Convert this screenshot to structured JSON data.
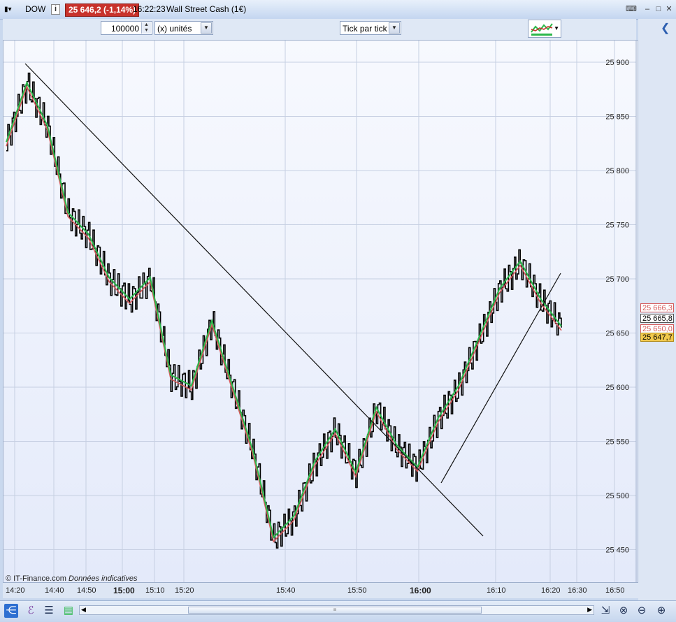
{
  "titlebar": {
    "symbol": "DOW",
    "price_badge": "25 646,2 (-1,14%)",
    "time": "16:22:23",
    "instrument": "Wall Street Cash (1€)"
  },
  "toolbar": {
    "quantity": "100000",
    "unit": "(x) unités",
    "timeframe": "Tick par tick"
  },
  "axis": {
    "y_ticks": [
      "25 900",
      "25 850",
      "25 800",
      "25 750",
      "25 700",
      "25 650",
      "25 600",
      "25 550",
      "25 500",
      "25 450"
    ],
    "x_ticks": [
      {
        "label": "14:20",
        "bold": false
      },
      {
        "label": "14:40",
        "bold": false
      },
      {
        "label": "14:50",
        "bold": false
      },
      {
        "label": "15:00",
        "bold": true
      },
      {
        "label": "15:10",
        "bold": false
      },
      {
        "label": "15:20",
        "bold": false
      },
      {
        "label": "15:40",
        "bold": false
      },
      {
        "label": "15:50",
        "bold": false
      },
      {
        "label": "16:00",
        "bold": true
      },
      {
        "label": "16:10",
        "bold": false
      },
      {
        "label": "16:20",
        "bold": false
      },
      {
        "label": "16:30",
        "bold": false
      },
      {
        "label": "16:50",
        "bold": false
      }
    ]
  },
  "price_tags": {
    "tag1": "25 666,3",
    "tag2": "25 665,8",
    "tag3": "25 650,0",
    "tag4": "25 647,7"
  },
  "watermark": {
    "source": "© IT-Finance.com",
    "note": "Données indicatives"
  },
  "colors": {
    "badge": "#c8322c",
    "ma_green": "#2bb84a",
    "ma_red": "#d55a5a",
    "price": "#000000"
  },
  "chart_data": {
    "type": "line",
    "ylim": [
      25420,
      25920
    ],
    "x": [
      "14:20",
      "14:30",
      "14:40",
      "14:50",
      "15:00",
      "15:10",
      "15:20",
      "15:30",
      "15:40",
      "15:50",
      "16:00",
      "16:10",
      "16:20",
      "16:25"
    ],
    "series": [
      {
        "values": [
          25825,
          25880,
          25840,
          25760,
          25740,
          25700,
          25680,
          25700,
          25610,
          25600,
          25660,
          25600,
          25540,
          25460,
          25480,
          25530,
          25560,
          25520,
          25580,
          25545,
          25525,
          25570,
          25600,
          25645,
          25690,
          25715,
          25680,
          25655
        ]
      }
    ]
  }
}
